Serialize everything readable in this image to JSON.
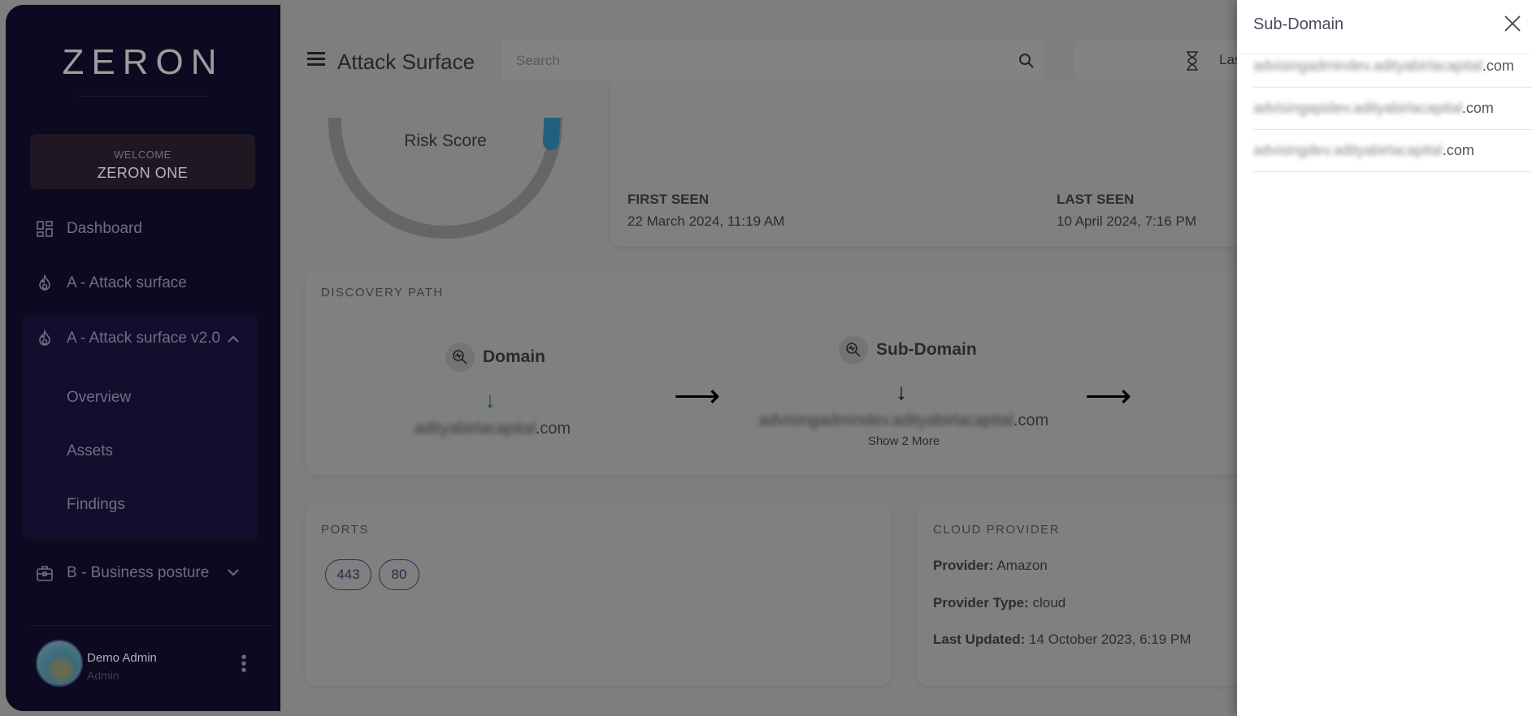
{
  "sidebar": {
    "logo": "ZERON",
    "welcome_label": "WELCOME",
    "org_name": "ZERON ONE",
    "items": [
      {
        "label": "Dashboard",
        "icon": "grid-icon"
      },
      {
        "label": "A - Attack surface",
        "icon": "flame-icon"
      },
      {
        "label": "A - Attack surface v2.0",
        "icon": "flame-icon",
        "expanded": true,
        "children": [
          {
            "label": "Overview"
          },
          {
            "label": "Assets"
          },
          {
            "label": "Findings"
          }
        ]
      },
      {
        "label": "B - Business posture",
        "icon": "briefcase-icon",
        "expanded": false
      }
    ],
    "user": {
      "name": "Demo Admin",
      "role": "Admin"
    }
  },
  "header": {
    "title": "Attack Surface",
    "search_placeholder": "Search",
    "time_filter": "Las"
  },
  "risk": {
    "label": "Risk Score",
    "accent": "#2a8fb8"
  },
  "seen": {
    "first_label": "FIRST SEEN",
    "first_value": "22 March 2024, 11:19 AM",
    "last_label": "LAST SEEN",
    "last_value": "10 April 2024, 7:16 PM"
  },
  "discovery": {
    "title": "DISCOVERY PATH",
    "nodes": [
      {
        "type": "Domain",
        "value_blurred": "adityabirlacapital",
        "value_suffix": ".com"
      },
      {
        "type": "Sub-Domain",
        "value_blurred": "advisingadmindev.adityabirlacapital",
        "value_suffix": ".com",
        "more": "Show 2 More"
      }
    ]
  },
  "ports": {
    "title": "PORTS",
    "values": [
      "443",
      "80"
    ]
  },
  "cloud": {
    "title": "CLOUD PROVIDER",
    "provider_label": "Provider:",
    "provider": "Amazon",
    "type_label": "Provider Type:",
    "type": "cloud",
    "updated_label": "Last Updated:",
    "updated": "14 October 2023, 6:19 PM"
  },
  "panel": {
    "title": "Sub-Domain",
    "items": [
      {
        "blurred": "advisingadmindev.adityabirlacapital",
        "suffix": ".com"
      },
      {
        "blurred": "advisingapidev.adityabirlacapital",
        "suffix": ".com"
      },
      {
        "blurred": "advisingdev.adityabirlacapital",
        "suffix": ".com"
      }
    ]
  }
}
